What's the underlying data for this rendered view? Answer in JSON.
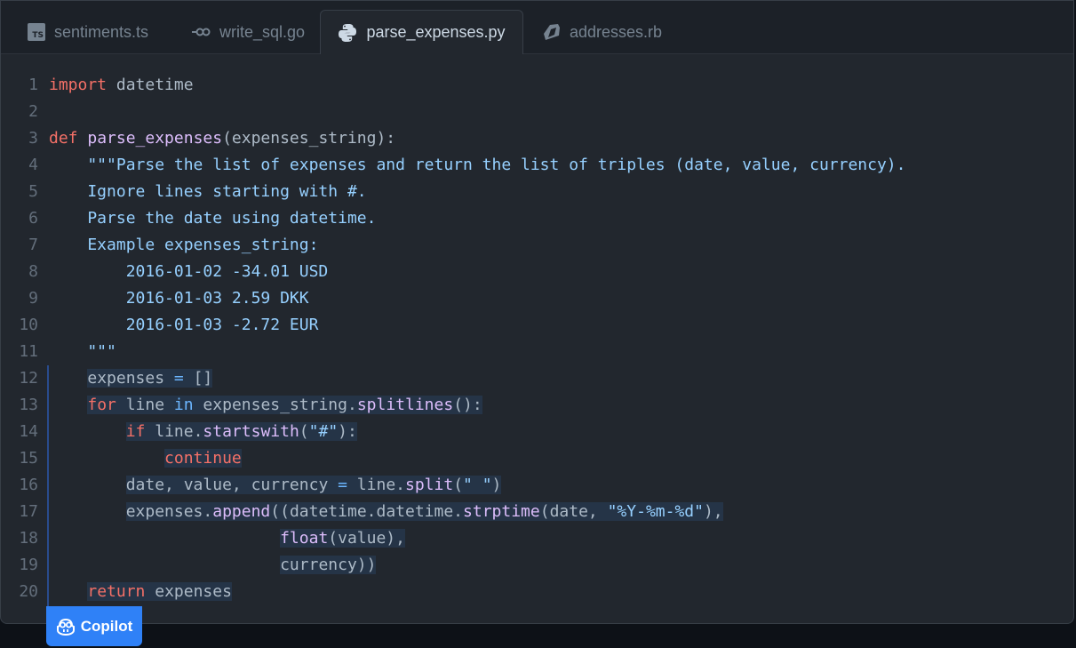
{
  "tabs": [
    {
      "label": "sentiments.ts",
      "icon": "typescript-icon",
      "icon_text": "TS"
    },
    {
      "label": "write_sql.go",
      "icon": "go-icon"
    },
    {
      "label": "parse_expenses.py",
      "icon": "python-icon",
      "active": true
    },
    {
      "label": "addresses.rb",
      "icon": "ruby-icon"
    }
  ],
  "code": {
    "line_numbers": [
      "1",
      "2",
      "3",
      "4",
      "5",
      "6",
      "7",
      "8",
      "9",
      "10",
      "11",
      "12",
      "13",
      "14",
      "15",
      "16",
      "17",
      "18",
      "19",
      "20"
    ],
    "lines": [
      [
        {
          "t": "import",
          "c": "kw"
        },
        {
          "t": " datetime"
        }
      ],
      [],
      [
        {
          "t": "def",
          "c": "kw"
        },
        {
          "t": " "
        },
        {
          "t": "parse_expenses",
          "c": "fn"
        },
        {
          "t": "(expenses_string):"
        }
      ],
      [
        {
          "t": "    \"\"\"Parse the list of expenses and return the list of triples (date, value, currency).",
          "c": "st"
        }
      ],
      [
        {
          "t": "    Ignore lines starting with #.",
          "c": "st"
        }
      ],
      [
        {
          "t": "    Parse the date using datetime.",
          "c": "st"
        }
      ],
      [
        {
          "t": "    Example expenses_string:",
          "c": "st"
        }
      ],
      [
        {
          "t": "        2016-01-02 -34.01 USD",
          "c": "st"
        }
      ],
      [
        {
          "t": "        2016-01-03 2.59 DKK",
          "c": "st"
        }
      ],
      [
        {
          "t": "        2016-01-03 -2.72 EUR",
          "c": "st"
        }
      ],
      [
        {
          "t": "    \"\"\"",
          "c": "st"
        }
      ],
      [
        {
          "t": "    "
        },
        {
          "t": "expenses ",
          "h": 1
        },
        {
          "t": "=",
          "c": "op",
          "h": 1
        },
        {
          "t": " []",
          "h": 1
        }
      ],
      [
        {
          "t": "    "
        },
        {
          "t": "for",
          "c": "kw",
          "h": 1
        },
        {
          "t": " line ",
          "h": 1
        },
        {
          "t": "in",
          "c": "op",
          "h": 1
        },
        {
          "t": " expenses_string.",
          "h": 1
        },
        {
          "t": "splitlines",
          "c": "fn",
          "h": 1
        },
        {
          "t": "():",
          "h": 1
        }
      ],
      [
        {
          "t": "        "
        },
        {
          "t": "if",
          "c": "kw",
          "h": 1
        },
        {
          "t": " line.",
          "h": 1
        },
        {
          "t": "startswith",
          "c": "fn",
          "h": 1
        },
        {
          "t": "(",
          "h": 1
        },
        {
          "t": "\"#\"",
          "c": "st",
          "h": 1
        },
        {
          "t": "):",
          "h": 1
        }
      ],
      [
        {
          "t": "            "
        },
        {
          "t": "continue",
          "c": "kw",
          "h": 1
        }
      ],
      [
        {
          "t": "        "
        },
        {
          "t": "date, value, currency ",
          "h": 1
        },
        {
          "t": "=",
          "c": "op",
          "h": 1
        },
        {
          "t": " line.",
          "h": 1
        },
        {
          "t": "split",
          "c": "fn",
          "h": 1
        },
        {
          "t": "(",
          "h": 1
        },
        {
          "t": "\" \"",
          "c": "st",
          "h": 1
        },
        {
          "t": ")",
          "h": 1
        }
      ],
      [
        {
          "t": "        "
        },
        {
          "t": "expenses.",
          "h": 1
        },
        {
          "t": "append",
          "c": "fn",
          "h": 1
        },
        {
          "t": "((datetime.datetime.",
          "h": 1
        },
        {
          "t": "strptime",
          "c": "fn",
          "h": 1
        },
        {
          "t": "(date, ",
          "h": 1
        },
        {
          "t": "\"%Y-%m-%d\"",
          "c": "st",
          "h": 1
        },
        {
          "t": "),",
          "h": 1
        }
      ],
      [
        {
          "t": "                        "
        },
        {
          "t": "float",
          "c": "fn",
          "h": 1
        },
        {
          "t": "(value),",
          "h": 1
        }
      ],
      [
        {
          "t": "                        "
        },
        {
          "t": "currency))",
          "h": 1
        }
      ],
      [
        {
          "t": "    "
        },
        {
          "t": "return",
          "c": "kw",
          "h": 1
        },
        {
          "t": " expenses",
          "h": 1
        }
      ]
    ]
  },
  "copilot": {
    "label": "Copilot",
    "icon": "copilot-icon"
  },
  "colors": {
    "background": "#22272e",
    "keyword": "#f47067",
    "function": "#dcbdfb",
    "string": "#96d0ff",
    "accent": "#2f81f7"
  }
}
